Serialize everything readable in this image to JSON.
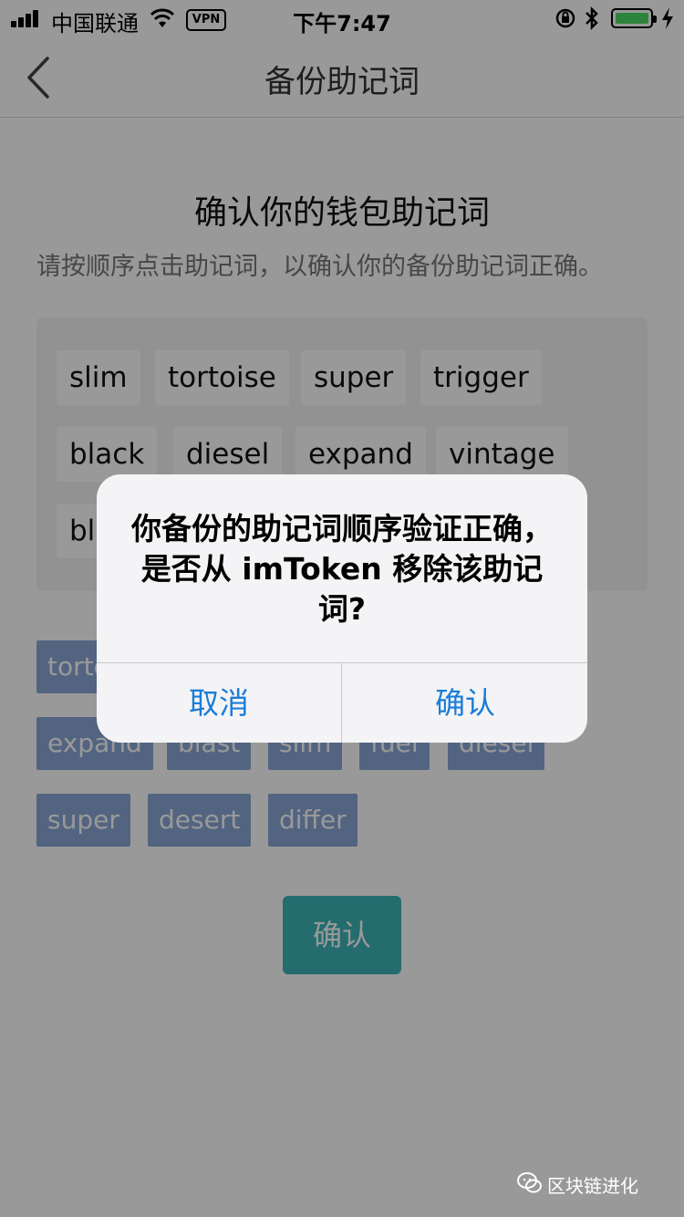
{
  "status_bar": {
    "carrier": "中国联通",
    "vpn": "VPN",
    "time": "下午7:47",
    "battery_level": 1.0,
    "battery_color": "#4cd964"
  },
  "nav": {
    "title": "备份助记词",
    "back_icon": "chevron-left-icon"
  },
  "page": {
    "heading": "确认你的钱包助记词",
    "instruction": "请按顺序点击助记词，以确认你的备份助记词正确。"
  },
  "selected_words": [
    "slim",
    "tortoise",
    "super",
    "trigger",
    "black",
    "diesel",
    "expand",
    "vintage",
    "black"
  ],
  "word_pool": [
    "tortoise",
    "expand",
    "blast",
    "slim",
    "fuel",
    "diesel",
    "super",
    "desert",
    "differ"
  ],
  "confirm_button": "确认",
  "accent_color": "#3db5b8",
  "alert": {
    "message": "你备份的助记词顺序验证正确，是否从 imToken 移除该助记词?",
    "cancel": "取消",
    "confirm": "确认",
    "button_color": "#1a7cd9"
  },
  "watermark": {
    "icon": "wechat-icon",
    "text": "区块链进化"
  }
}
